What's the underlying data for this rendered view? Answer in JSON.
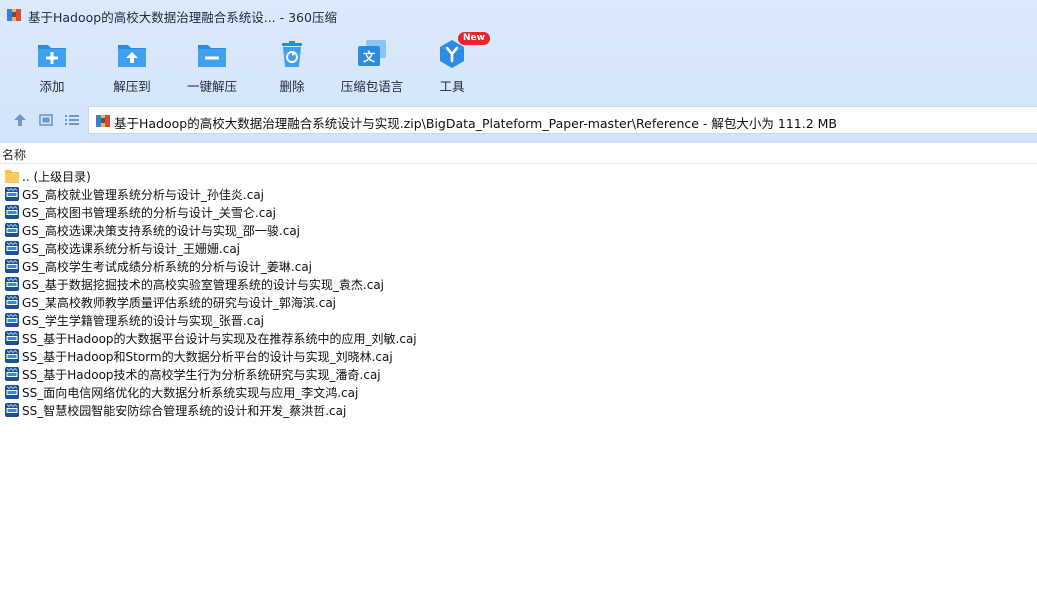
{
  "window": {
    "title": "基于Hadoop的高校大数据治理融合系统设... - 360压缩"
  },
  "toolbar": {
    "items": [
      {
        "label": "添加",
        "icon": "add-icon"
      },
      {
        "label": "解压到",
        "icon": "extract-to-icon"
      },
      {
        "label": "一键解压",
        "icon": "one-click-extract-icon"
      },
      {
        "label": "删除",
        "icon": "delete-icon"
      },
      {
        "label": "压缩包语言",
        "icon": "language-icon"
      },
      {
        "label": "工具",
        "icon": "tools-icon",
        "badge": "New"
      }
    ]
  },
  "address": {
    "path": "基于Hadoop的高校大数据治理融合系统设计与实现.zip\\BigData_Plateform_Paper-master\\Reference - 解包大小为 111.2 MB"
  },
  "list": {
    "column_name": "名称",
    "parent": ".. (上级目录)",
    "files": [
      "GS_高校就业管理系统分析与设计_孙佳炎.caj",
      "GS_高校图书管理系统的分析与设计_关雪仑.caj",
      "GS_高校选课决策支持系统的设计与实现_邵一骏.caj",
      "GS_高校选课系统分析与设计_王姗姗.caj",
      "GS_高校学生考试成绩分析系统的分析与设计_姜琳.caj",
      "GS_基于数据挖掘技术的高校实验室管理系统的设计与实现_袁杰.caj",
      "GS_某高校教师教学质量评估系统的研究与设计_郭海滨.caj",
      "GS_学生学籍管理系统的设计与实现_张晋.caj",
      "SS_基于Hadoop的大数据平台设计与实现及在推荐系统中的应用_刘敏.caj",
      "SS_基于Hadoop和Storm的大数据分析平台的设计与实现_刘晓林.caj",
      "SS_基于Hadoop技术的高校学生行为分析系统研究与实现_潘奇.caj",
      "SS_面向电信网络优化的大数据分析系统实现与应用_李文鸿.caj",
      "SS_智慧校园智能安防综合管理系统的设计和开发_蔡洪哲.caj"
    ]
  },
  "colors": {
    "toolbar_bg": "#d6e6fb",
    "icon_blue": "#2a8be0",
    "folder_yellow": "#f6cd5b",
    "badge_red": "#e8252a"
  }
}
